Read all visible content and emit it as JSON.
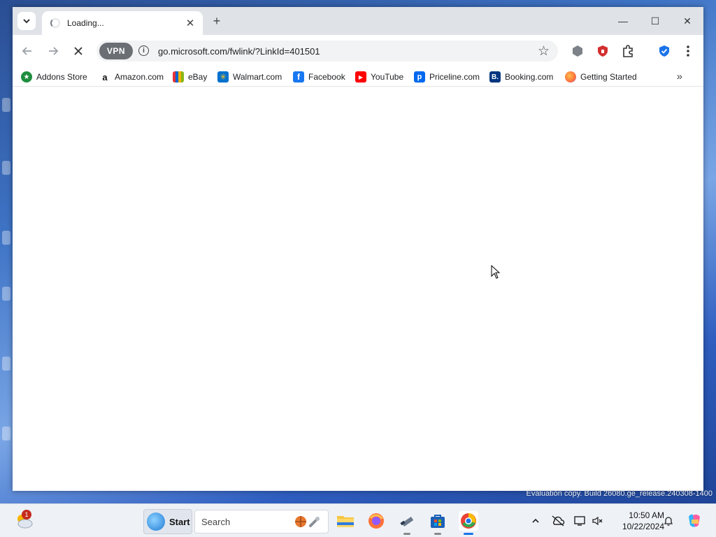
{
  "browser": {
    "tab": {
      "title": "Loading...",
      "close_symbol": "✕"
    },
    "new_tab_symbol": "+",
    "window_controls": {
      "minimize": "—",
      "maximize": "☐",
      "close": "✕"
    },
    "address_bar": {
      "vpn_label": "VPN",
      "url": "go.microsoft.com/fwlink/?LinkId=401501"
    },
    "bookmarks": [
      {
        "label": "Addons Store",
        "icon": "addons-store-icon",
        "color": "#1e8e3e"
      },
      {
        "label": "Amazon.com",
        "icon": "amazon-icon",
        "color": "#111111"
      },
      {
        "label": "eBay",
        "icon": "ebay-icon",
        "color": "#e53238"
      },
      {
        "label": "Walmart.com",
        "icon": "walmart-icon",
        "color": "#0071ce"
      },
      {
        "label": "Facebook",
        "icon": "facebook-icon",
        "color": "#1877f2"
      },
      {
        "label": "YouTube",
        "icon": "youtube-icon",
        "color": "#ff0000"
      },
      {
        "label": "Priceline.com",
        "icon": "priceline-icon",
        "color": "#0068ef"
      },
      {
        "label": "Booking.com",
        "icon": "booking-icon",
        "color": "#003580"
      },
      {
        "label": "Getting Started",
        "icon": "firefox-icon",
        "color": "#ff7139"
      }
    ],
    "bookmarks_overflow_symbol": "»"
  },
  "watermark": "Evaluation copy. Build 26080.ge_release.240308-1400",
  "taskbar": {
    "notification_count": "1",
    "start_label": "Start",
    "search_placeholder": "Search",
    "clock": {
      "time": "10:50 AM",
      "date": "10/22/2024"
    }
  }
}
